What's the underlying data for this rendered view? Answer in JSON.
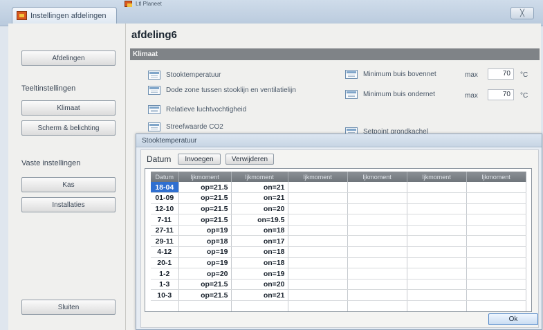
{
  "window": {
    "tab_title": "Instellingen afdelingen",
    "inactive_tab_title": "Ltl Planeet",
    "close_glyph": "╳"
  },
  "sidebar": {
    "afdelingen_label": "Afdelingen",
    "teeltinstellingen_heading": "Teeltinstellingen",
    "klimaat_label": "Klimaat",
    "scherm_label": "Scherm & belichting",
    "vaste_heading": "Vaste instellingen",
    "kas_label": "Kas",
    "installaties_label": "Installaties",
    "sluiten_label": "Sluiten"
  },
  "main": {
    "title": "afdeling6",
    "section": "Klimaat",
    "settings_left": [
      {
        "label": "Stooktemperatuur",
        "icon": "graph-icon"
      },
      {
        "label": "Dode zone tussen stooklijn en ventilatielijn",
        "icon": "graph-icon"
      },
      {
        "label": "Relatieve luchtvochtigheid",
        "icon": "graph-icon"
      },
      {
        "label": "Streefwaarde CO2",
        "icon": "graph-icon"
      }
    ],
    "settings_right": [
      {
        "label": "Minimum buis bovennet",
        "max_label": "max",
        "value": "70",
        "unit": "°C"
      },
      {
        "label": "Minimum buis ondernet",
        "max_label": "max",
        "value": "70",
        "unit": "°C"
      },
      {
        "label": "Setpoint grondkachel"
      }
    ]
  },
  "dialog": {
    "title": "Stooktemperatuur",
    "datum_label": "Datum",
    "invoegen_label": "Invoegen",
    "verwijderen_label": "Verwijderen",
    "ok_label": "Ok",
    "columns": [
      "Datum",
      "Ijkmoment",
      "Ijkmoment",
      "Ijkmoment",
      "Ijkmoment",
      "Ijkmoment",
      "Ijkmoment"
    ],
    "rows": [
      [
        "18-04",
        "op=21.5",
        "on=21"
      ],
      [
        "01-09",
        "op=21.5",
        "on=21"
      ],
      [
        "12-10",
        "op=21.5",
        "on=20"
      ],
      [
        "7-11",
        "op=21.5",
        "on=19.5"
      ],
      [
        "27-11",
        "op=19",
        "on=18"
      ],
      [
        "29-11",
        "op=18",
        "on=17"
      ],
      [
        "4-12",
        "op=19",
        "on=18"
      ],
      [
        "20-1",
        "op=19",
        "on=18"
      ],
      [
        "1-2",
        "op=20",
        "on=19"
      ],
      [
        "1-3",
        "op=21.5",
        "on=20"
      ],
      [
        "10-3",
        "op=21.5",
        "on=21"
      ]
    ],
    "empty_rows": 3
  }
}
